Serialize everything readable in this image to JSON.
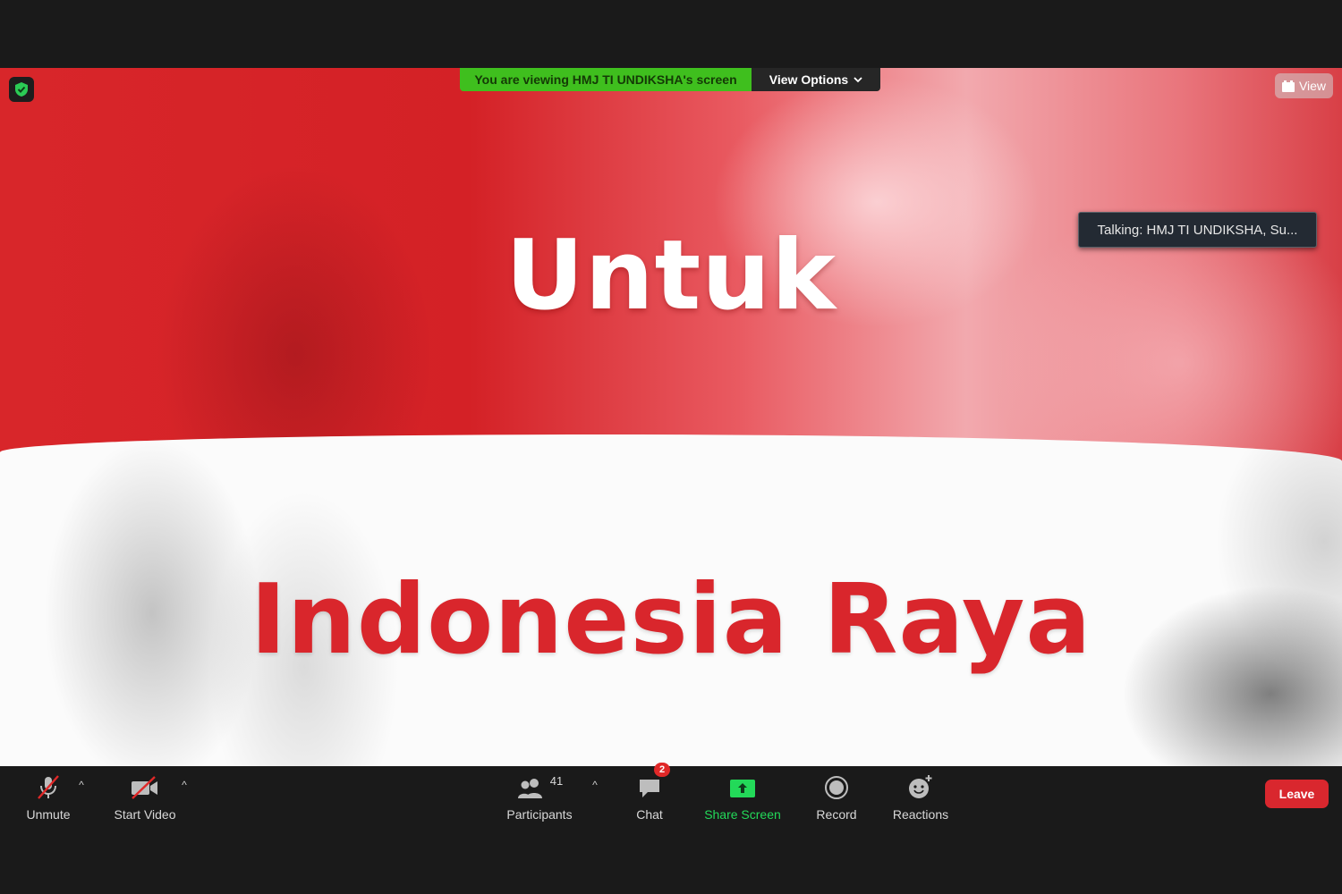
{
  "share": {
    "viewing_label": "You are viewing HMJ TI UNDIKSHA's screen",
    "view_options_label": "View Options",
    "view_label": "View",
    "talking": "Talking: HMJ TI UNDIKSHA, Su...",
    "content": {
      "line1": "Untuk",
      "line2": "Indonesia Raya"
    }
  },
  "toolbar": {
    "unmute": "Unmute",
    "start_video": "Start Video",
    "participants": "Participants",
    "participants_count": "41",
    "chat": "Chat",
    "chat_badge": "2",
    "share_screen": "Share Screen",
    "record": "Record",
    "reactions": "Reactions",
    "leave": "Leave"
  },
  "colors": {
    "accent_green": "#3fbf1e",
    "share_green": "#23d959",
    "leave_red": "#d9272e"
  },
  "icons": [
    "shield-check-icon",
    "chevron-down-icon",
    "grid-view-icon",
    "mic-muted-icon",
    "video-off-icon",
    "participants-icon",
    "chat-icon",
    "share-screen-icon",
    "record-icon",
    "reactions-icon"
  ]
}
